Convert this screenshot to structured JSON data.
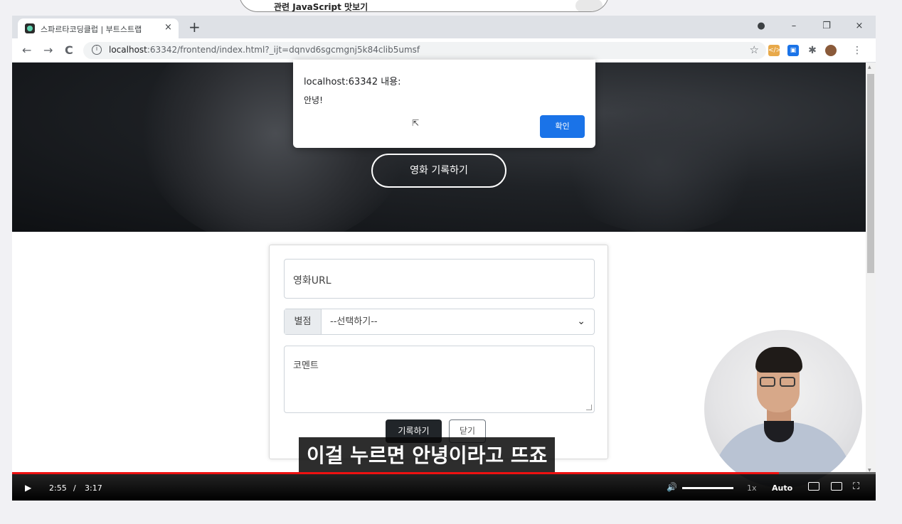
{
  "top_note": {
    "text": "관련 JavaScript 맛보기"
  },
  "browser": {
    "tab_title": "스파르타코딩클럽 | 부트스트랩",
    "tab_close": "×",
    "new_tab": "+",
    "url_host": "localhost",
    "url_rest": ":63342/frontend/index.html?_ijt=dqnvd6sgcmgnj5k84clib5umsf",
    "nav": {
      "back": "←",
      "forward": "→",
      "reload": "C"
    },
    "window_controls": {
      "minimize": "–",
      "restore": "❐",
      "close": "×"
    },
    "star": "☆",
    "menu": "⋮"
  },
  "hero": {
    "record_button": "영화 기록하기"
  },
  "form": {
    "url_placeholder": "영화URL",
    "rating_label": "별점",
    "rating_selected": "--선택하기--",
    "comment_placeholder": "코멘트",
    "save_button": "기록하기",
    "close_button": "닫기"
  },
  "alert": {
    "title": "localhost:63342 내용:",
    "message": "안녕!",
    "ok_button": "확인"
  },
  "subtitle": {
    "text": "이걸 누르면 안녕이라고 뜨죠"
  },
  "video": {
    "current_time": "2:55",
    "separator": "/",
    "duration": "3:17",
    "progress_fraction": 0.888,
    "speed": "1x",
    "quality": "Auto"
  },
  "colors": {
    "accent_blue": "#1a73e8",
    "progress_red": "#e11111",
    "dark_button": "#212529"
  }
}
